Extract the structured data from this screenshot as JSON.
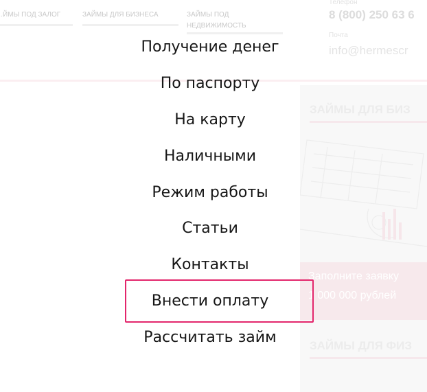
{
  "background": {
    "nav_items": [
      {
        "label": "…ЙМЫ ПОД ЗАЛОГ"
      },
      {
        "label": "ЗАЙМЫ ДЛЯ БИЗНЕСА"
      },
      {
        "label_line1": "ЗАЙМЫ ПОД",
        "label_line2": "НЕДВИЖИМОСТЬ"
      }
    ],
    "phone_label": "Телефон",
    "phone": "8 (800) 250 63 6",
    "mail_label": "Почта",
    "mail": "info@hermescr",
    "panel_title_1": "ЗАЙМЫ ДЛЯ БИЗ",
    "cta_line1": "Заполните заявку",
    "cta_line2": "1 000 000 рублей",
    "panel_title_2": "ЗАЙМЫ ДЛЯ ФИЗ"
  },
  "menu": {
    "items": [
      {
        "label": "Получение денег"
      },
      {
        "label": "По паспорту"
      },
      {
        "label": "На карту"
      },
      {
        "label": "Наличными"
      },
      {
        "label": "Режим работы"
      },
      {
        "label": "Статьи"
      },
      {
        "label": "Контакты"
      },
      {
        "label": "Внести оплату"
      },
      {
        "label": "Рассчитать займ"
      }
    ]
  },
  "colors": {
    "highlight": "#e3256b",
    "text": "#161616",
    "background": "#ffffff"
  }
}
